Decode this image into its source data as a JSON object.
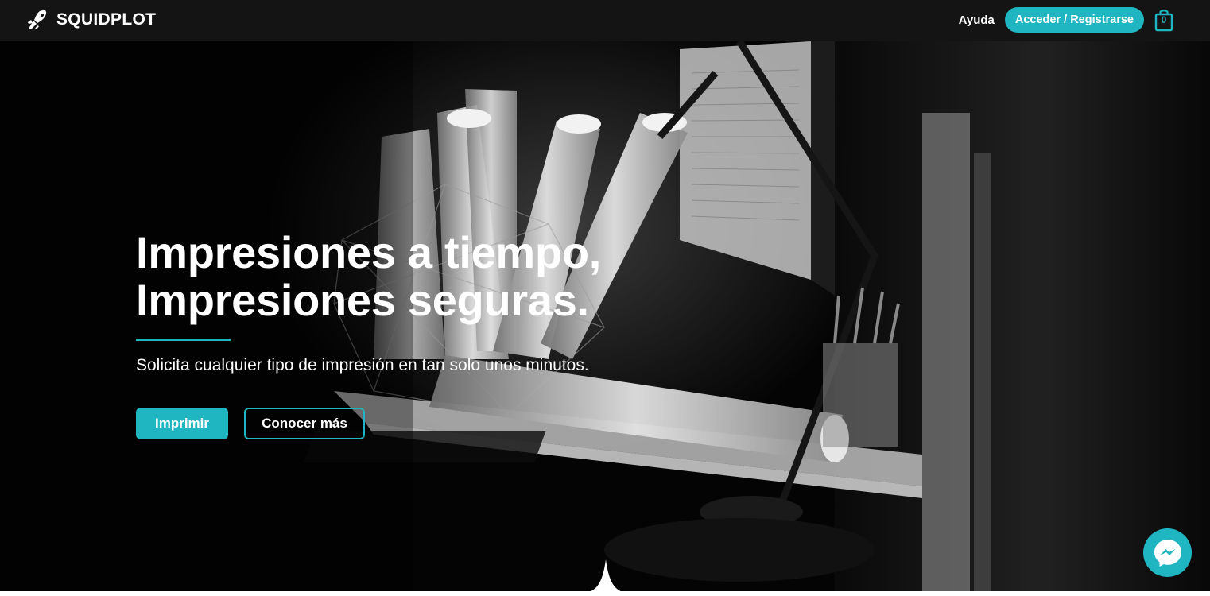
{
  "header": {
    "brand": "SQUIDPLOT",
    "help_label": "Ayuda",
    "login_label": "Acceder / Registrarse",
    "cart_count": "0"
  },
  "hero": {
    "title_line_1": "Impresiones a tiempo,",
    "title_line_2": "Impresiones seguras.",
    "subtitle": "Solicita cualquier tipo de impresión en tan solo unos minutos.",
    "primary_button": "Imprimir",
    "secondary_button": "Conocer más"
  },
  "colors": {
    "accent": "#1fb6c2",
    "header_bg": "#141414",
    "hero_bg": "#040404"
  },
  "icons": {
    "logo": "squid-rocket-icon",
    "cart": "shopping-bag-icon",
    "chat": "messenger-icon"
  }
}
